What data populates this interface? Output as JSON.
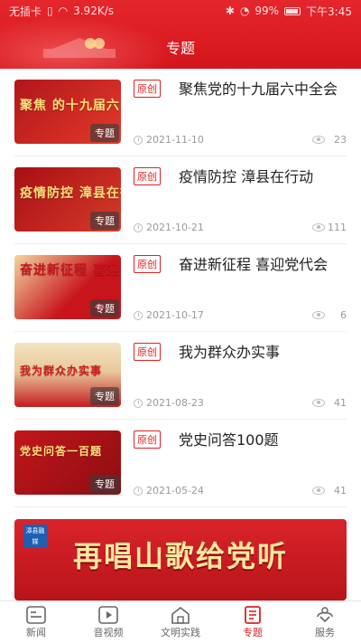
{
  "status_bar": {
    "carrier": "无插卡",
    "speed": "3.92K/s",
    "battery": "99%",
    "time": "下午3:45"
  },
  "header": {
    "title": "专题",
    "accent_color": "#e5262c"
  },
  "items": [
    {
      "badge": "原创",
      "title": "聚焦党的十九届六中全会",
      "date": "2021-11-10",
      "views": "23",
      "thumb_text": "聚焦 的十九届六中全",
      "thumb_tag": "专题"
    },
    {
      "badge": "原创",
      "title": "疫情防控 漳县在行动",
      "date": "2021-10-21",
      "views": "111",
      "thumb_text": "疫情防控 漳县在行动",
      "thumb_tag": "专题"
    },
    {
      "badge": "原创",
      "title": "奋进新征程 喜迎党代会",
      "date": "2021-10-17",
      "views": "6",
      "thumb_text": "奋进新征程 喜迎党代",
      "thumb_tag": "专题"
    },
    {
      "badge": "原创",
      "title": "我为群众办实事",
      "date": "2021-08-23",
      "views": "41",
      "thumb_text": "我为群众办实事",
      "thumb_tag": "专题"
    },
    {
      "badge": "原创",
      "title": "党史问答100题",
      "date": "2021-05-24",
      "views": "41",
      "thumb_text": "党史问答一百题",
      "thumb_tag": "专题"
    }
  ],
  "banner": {
    "text": "再唱山歌给党听",
    "corner_text": "漳县融媒"
  },
  "bottom_nav": [
    {
      "label": "新闻",
      "icon": "news-icon"
    },
    {
      "label": "音视频",
      "icon": "video-icon"
    },
    {
      "label": "文明实践",
      "icon": "house-icon"
    },
    {
      "label": "专题",
      "icon": "topic-icon",
      "active": true
    },
    {
      "label": "服务",
      "icon": "service-icon"
    }
  ]
}
